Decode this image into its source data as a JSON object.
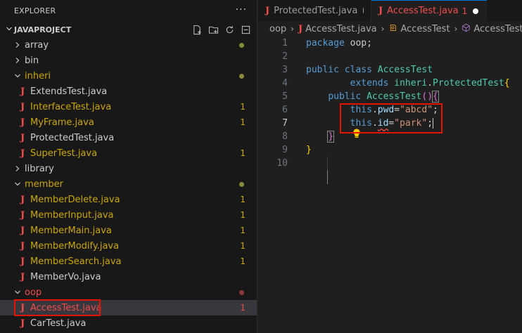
{
  "sidebar": {
    "title": "EXPLORER",
    "more": "···",
    "project": "JAVAPROJECT",
    "tree": [
      {
        "type": "folder",
        "name": "array",
        "open": false,
        "dot": "#8a8a3a"
      },
      {
        "type": "folder",
        "name": "bin",
        "open": false
      },
      {
        "type": "folder",
        "name": "inheri",
        "open": true,
        "dot": "#8a8a3a",
        "color": "yellow"
      },
      {
        "type": "file",
        "name": "ExtendsTest.java",
        "color": "white"
      },
      {
        "type": "file",
        "name": "InterfaceTest.java",
        "color": "yellow",
        "badge": "1"
      },
      {
        "type": "file",
        "name": "MyFrame.java",
        "color": "yellow",
        "badge": "1"
      },
      {
        "type": "file",
        "name": "ProtectedTest.java",
        "color": "white"
      },
      {
        "type": "file",
        "name": "SuperTest.java",
        "color": "yellow",
        "badge": "1"
      },
      {
        "type": "folder",
        "name": "library",
        "open": false
      },
      {
        "type": "folder",
        "name": "member",
        "open": true,
        "dot": "#8a8a3a",
        "color": "yellow"
      },
      {
        "type": "file",
        "name": "MemberDelete.java",
        "color": "yellow",
        "badge": "1"
      },
      {
        "type": "file",
        "name": "MemberInput.java",
        "color": "yellow",
        "badge": "1"
      },
      {
        "type": "file",
        "name": "MemberMain.java",
        "color": "yellow",
        "badge": "1"
      },
      {
        "type": "file",
        "name": "MemberModify.java",
        "color": "yellow",
        "badge": "1"
      },
      {
        "type": "file",
        "name": "MemberSearch.java",
        "color": "yellow",
        "badge": "1"
      },
      {
        "type": "file",
        "name": "MemberVo.java",
        "color": "white"
      },
      {
        "type": "folder",
        "name": "oop",
        "open": true,
        "dot": "#8a3a3a",
        "color": "red"
      },
      {
        "type": "file",
        "name": "AccessTest.java",
        "color": "red",
        "badge": "1",
        "selected": true
      },
      {
        "type": "file",
        "name": "CarTest.java",
        "color": "white"
      }
    ]
  },
  "tabs": [
    {
      "label": "ProtectedTest.java",
      "active": false
    },
    {
      "label": "AccessTest.java",
      "active": true,
      "problems": "1"
    }
  ],
  "breadcrumb": {
    "folder": "oop",
    "file": "AccessTest.java",
    "cls": "AccessTest",
    "method": "AccessTest()"
  },
  "code": {
    "line_numbers": [
      "1",
      "2",
      "3",
      "4",
      "5",
      "6",
      "7",
      "8",
      "9",
      "10"
    ],
    "l1_kw": "package",
    "l1_rest": " oop;",
    "l3_kw1": "public",
    "l3_kw2": "class",
    "l3_cls": "AccessTest",
    "l4_kw": "extends",
    "l4_pkg": "inheri",
    "l4_dot": ".",
    "l4_cls": "ProtectedTest",
    "l4_br": "{",
    "l5_kw": "public",
    "l5_name": "AccessTest",
    "l5_p1": "(",
    "l5_p2": ")",
    "l5_br": "{",
    "l6_this": "this",
    "l6_dot": ".",
    "l6_fld": "pwd",
    "l6_eq": "=",
    "l6_str": "\"abcd\"",
    "l6_end": ";",
    "l7_this": "this",
    "l7_dot": ".",
    "l7_fld": "id",
    "l7_eq": "=",
    "l7_str": "\"park\"",
    "l7_end": ";",
    "l8_br": "}",
    "l9_br": "}"
  }
}
